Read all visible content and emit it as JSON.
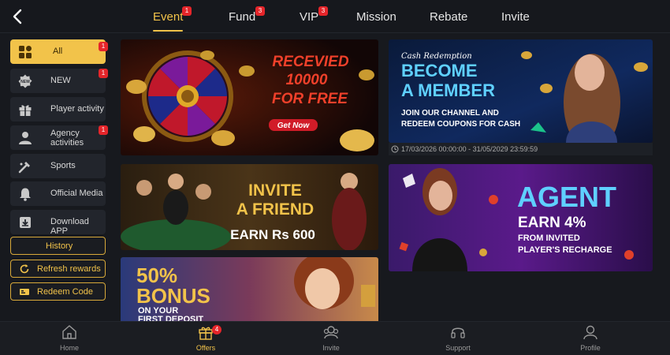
{
  "colors": {
    "accent": "#f2c34a",
    "badge": "#e5252a",
    "background": "#17191e",
    "panel": "#22252c"
  },
  "top_tabs": [
    {
      "label": "Event",
      "badge": "1",
      "active": true
    },
    {
      "label": "Fund",
      "badge": "3"
    },
    {
      "label": "VIP",
      "badge": "3"
    },
    {
      "label": "Mission"
    },
    {
      "label": "Rebate"
    },
    {
      "label": "Invite"
    }
  ],
  "sidebar": {
    "items": [
      {
        "label": "All",
        "badge": "1",
        "icon": "grid-icon",
        "active": true
      },
      {
        "label": "NEW",
        "badge": "1",
        "icon": "new-icon"
      },
      {
        "label": "Player activity",
        "icon": "gift-icon"
      },
      {
        "label": "Agency activities",
        "badge": "1",
        "icon": "agent-icon"
      },
      {
        "label": "Sports",
        "icon": "sports-icon"
      },
      {
        "label": "Official Media",
        "icon": "bell-icon"
      },
      {
        "label": "Download APP",
        "icon": "download-icon"
      }
    ],
    "buttons": [
      {
        "label": "History"
      },
      {
        "label": "Refresh rewards",
        "icon": "refresh-icon"
      },
      {
        "label": "Redeem Code",
        "icon": "ticket-icon"
      }
    ]
  },
  "banners": {
    "spin": {
      "line1": "RECEVIED",
      "line2": "10000",
      "line3": "FOR FREE",
      "cta": "Get Now"
    },
    "member": {
      "script": "Cash Redemption",
      "line1": "BECOME",
      "line2": "A MEMBER",
      "sub1": "JOIN OUR CHANNEL AND",
      "sub2": "REDEEM COUPONS FOR CASH",
      "date_range": "17/03/2026 00:00:00 - 31/05/2029 23:59:59"
    },
    "invite": {
      "line1": "INVITE",
      "line2": "A FRIEND",
      "line3": "EARN Rs 600"
    },
    "agent": {
      "line1": "AGENT",
      "line2": "EARN 4%",
      "sub1": "FROM INVITED",
      "sub2": "PLAYER'S RECHARGE"
    },
    "bonus": {
      "line1": "50%",
      "line2": "BONUS",
      "line3": "ON YOUR",
      "line4": "FIRST DEPOSIT"
    }
  },
  "bottom_nav": [
    {
      "label": "Home",
      "icon": "home-icon"
    },
    {
      "label": "Offers",
      "icon": "gift-icon",
      "badge": "4",
      "active": true
    },
    {
      "label": "Invite",
      "icon": "invite-icon"
    },
    {
      "label": "Support",
      "icon": "headset-icon"
    },
    {
      "label": "Profile",
      "icon": "profile-icon"
    }
  ]
}
